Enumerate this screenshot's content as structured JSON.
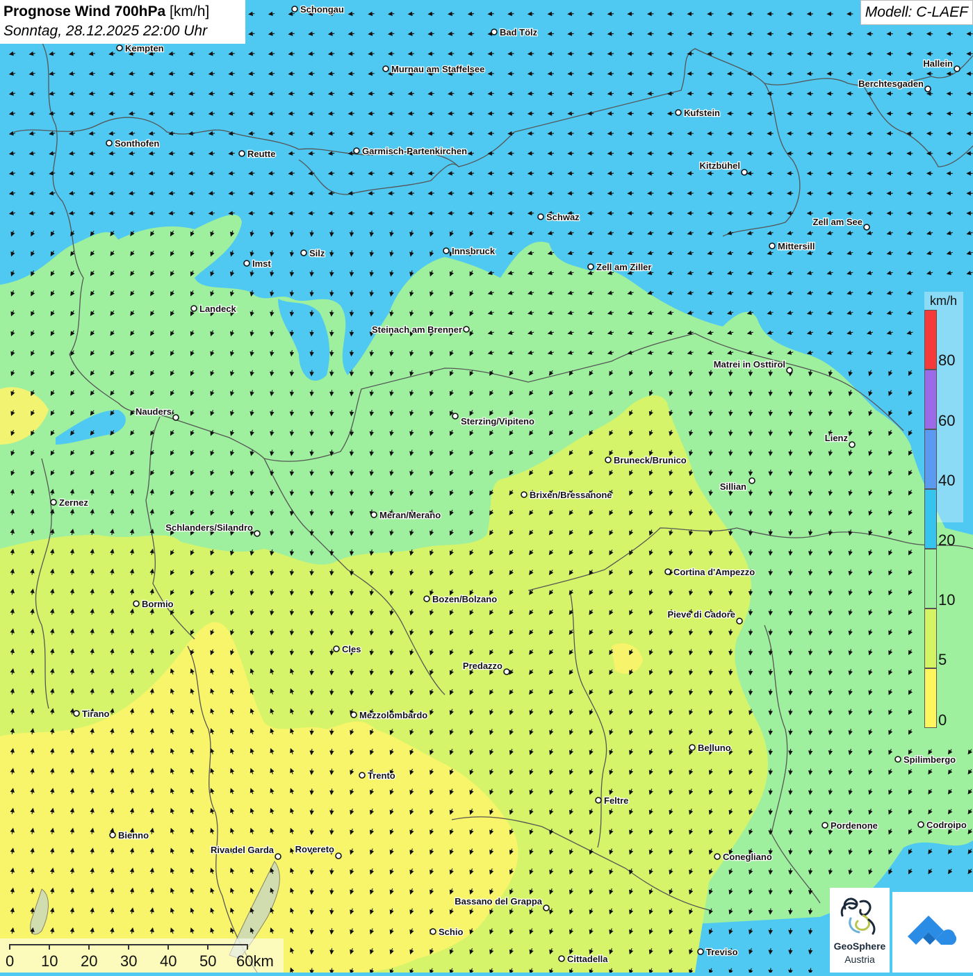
{
  "header": {
    "title_bold": "Prognose Wind 700hPa",
    "title_unit": "[km/h]",
    "datetime": "Sonntag, 28.12.2025 22:00 Uhr",
    "model": "Modell: C-LAEF"
  },
  "legend": {
    "unit": "km/h",
    "labels": [
      "80",
      "60",
      "40",
      "20",
      "10",
      "5",
      "0"
    ],
    "colors": [
      "#f63a3a",
      "#9a6ae8",
      "#5a9af0",
      "#34c4ee",
      "#9cf09c",
      "#d4f464",
      "#fef65c"
    ]
  },
  "colors": {
    "zone_high_wind": "#4fc8f2",
    "zone_mid_wind": "#9ef09e",
    "zone_low_wind": "#d6f46a",
    "zone_calm": "#fbf46c",
    "borders": "#555555"
  },
  "scalebar": {
    "labels": [
      "0",
      "10",
      "20",
      "30",
      "40",
      "50",
      "60km"
    ]
  },
  "cities": [
    {
      "name": "Schongau"
    },
    {
      "name": "Bad Tölz"
    },
    {
      "name": "Kempten"
    },
    {
      "name": "Murnau am Staffelsee"
    },
    {
      "name": "Hallein"
    },
    {
      "name": "Berchtesgaden"
    },
    {
      "name": "Kufstein"
    },
    {
      "name": "Sonthofen"
    },
    {
      "name": "Reutte"
    },
    {
      "name": "Garmisch-Partenkirchen"
    },
    {
      "name": "Kitzbühel"
    },
    {
      "name": "Schwaz"
    },
    {
      "name": "Zell am See"
    },
    {
      "name": "Mittersill"
    },
    {
      "name": "Innsbruck"
    },
    {
      "name": "Imst"
    },
    {
      "name": "Silz"
    },
    {
      "name": "Zell am Ziller"
    },
    {
      "name": "Landeck"
    },
    {
      "name": "Steinach am Brenner"
    },
    {
      "name": "Matrei in Osttirol"
    },
    {
      "name": "Nauders"
    },
    {
      "name": "Sterzing/Vipiteno"
    },
    {
      "name": "Lienz"
    },
    {
      "name": "Bruneck/Brunico"
    },
    {
      "name": "Sillian"
    },
    {
      "name": "Brixen/Bressanone"
    },
    {
      "name": "Zernez"
    },
    {
      "name": "Meran/Merano"
    },
    {
      "name": "Schlanders/Silandro"
    },
    {
      "name": "Cortina d'Ampezzo"
    },
    {
      "name": "Bozen/Bolzano"
    },
    {
      "name": "Bormio"
    },
    {
      "name": "Pieve di Cadore"
    },
    {
      "name": "Cles"
    },
    {
      "name": "Predazzo"
    },
    {
      "name": "Tirano"
    },
    {
      "name": "Mezzolombardo"
    },
    {
      "name": "Belluno"
    },
    {
      "name": "Spilimbergo"
    },
    {
      "name": "Trento"
    },
    {
      "name": "Feltre"
    },
    {
      "name": "Pordenone"
    },
    {
      "name": "Codroipo"
    },
    {
      "name": "Bienno"
    },
    {
      "name": "Riva del Garda"
    },
    {
      "name": "Rovereto"
    },
    {
      "name": "Conegliano"
    },
    {
      "name": "Bassano del Grappa"
    },
    {
      "name": "Schio"
    },
    {
      "name": "Treviso"
    },
    {
      "name": "Cittadella"
    }
  ],
  "logo": {
    "name_line1": "GeoSphere",
    "name_line2": "Austria"
  }
}
